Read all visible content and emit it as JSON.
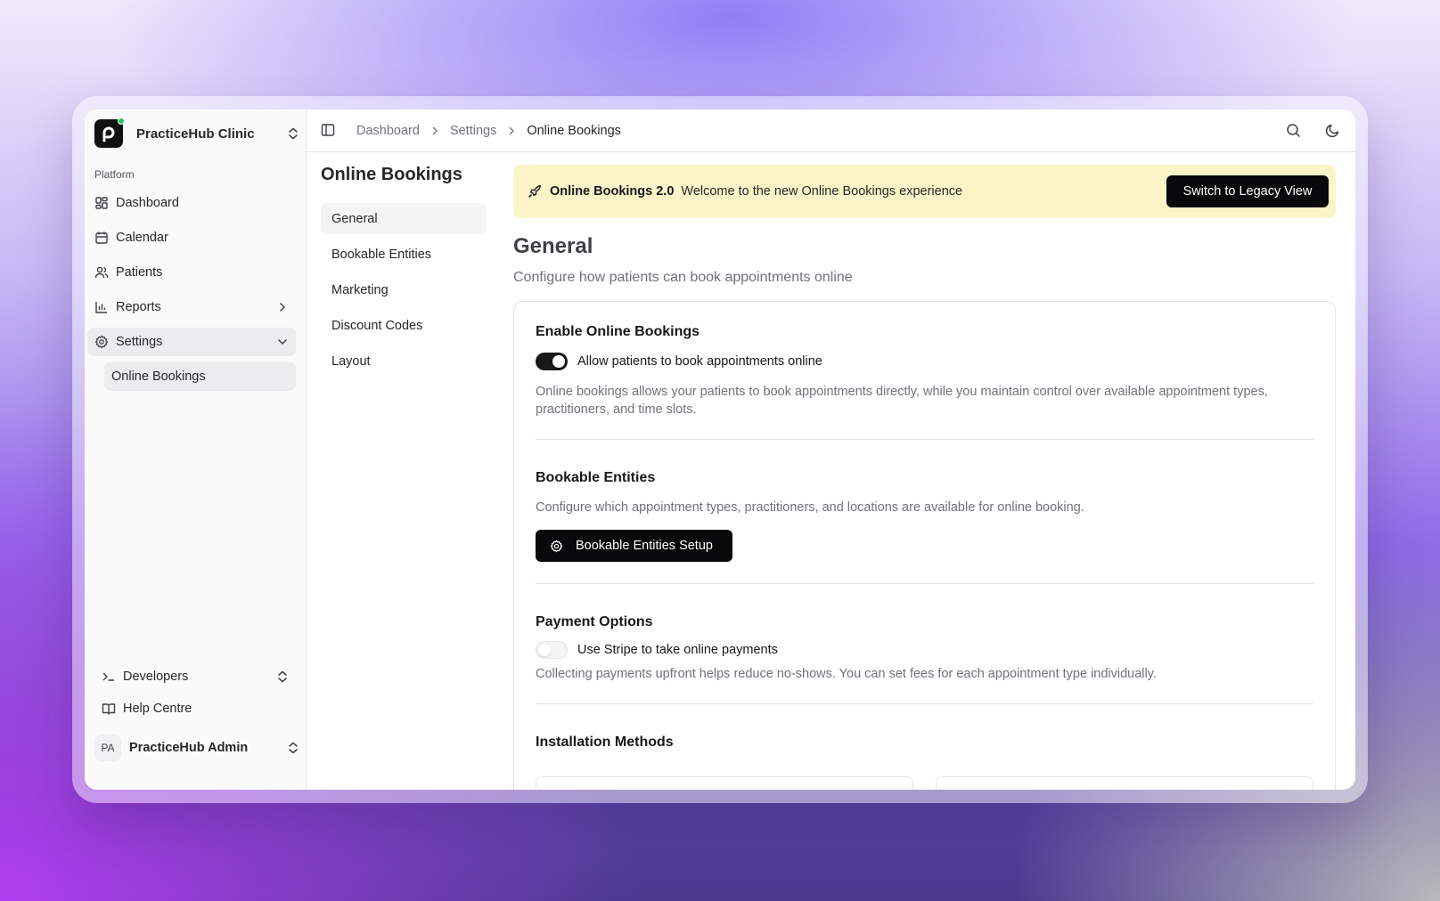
{
  "org": {
    "name": "PracticeHub Clinic"
  },
  "sidebar": {
    "group_label": "Platform",
    "items": [
      {
        "label": "Dashboard",
        "icon": "dashboard-icon"
      },
      {
        "label": "Calendar",
        "icon": "calendar-icon"
      },
      {
        "label": "Patients",
        "icon": "users-icon"
      },
      {
        "label": "Reports",
        "icon": "bar-chart-icon"
      },
      {
        "label": "Settings",
        "icon": "gear-icon"
      }
    ],
    "sub_item": "Online Bookings",
    "bottom": [
      {
        "label": "Developers",
        "icon": "terminal-icon"
      },
      {
        "label": "Help Centre",
        "icon": "book-icon"
      }
    ],
    "user": {
      "initials": "PA",
      "name": "PracticeHub Admin"
    }
  },
  "breadcrumb": [
    "Dashboard",
    "Settings",
    "Online Bookings"
  ],
  "subnav": {
    "title": "Online Bookings",
    "items": [
      "General",
      "Bookable Entities",
      "Marketing",
      "Discount Codes",
      "Layout"
    ]
  },
  "banner": {
    "title": "Online Bookings 2.0",
    "text": "Welcome to the new Online Bookings experience",
    "button": "Switch to Legacy View"
  },
  "page": {
    "title": "General",
    "description": "Configure how patients can book appointments online"
  },
  "sections": {
    "enable": {
      "title": "Enable Online Bookings",
      "toggle_label": "Allow patients to book appointments online",
      "toggle_on": true,
      "help": "Online bookings allows your patients to book appointments directly, while you maintain control over available appointment types, practitioners, and time slots."
    },
    "entities": {
      "title": "Bookable Entities",
      "help": "Configure which appointment types, practitioners, and locations are available for online booking.",
      "button": "Bookable Entities Setup"
    },
    "payment": {
      "title": "Payment Options",
      "toggle_label": "Use Stripe to take online payments",
      "toggle_on": false,
      "help": "Collecting payments upfront helps reduce no-shows. You can set fees for each appointment type individually."
    },
    "install": {
      "title": "Installation Methods"
    }
  }
}
